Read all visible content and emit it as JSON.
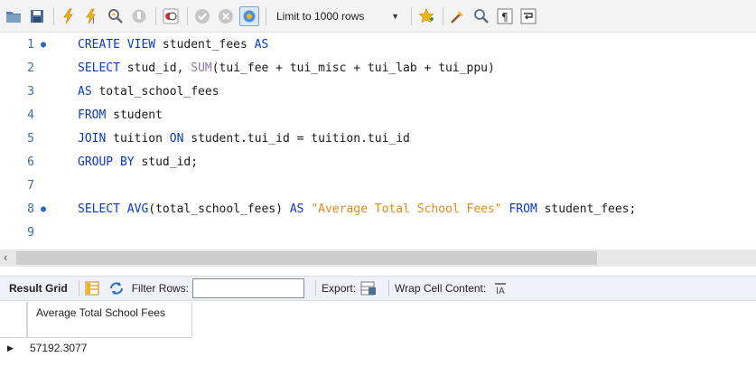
{
  "toolbar": {
    "limit_label": "Limit to 1000 rows",
    "buttons": [
      "open-folder-icon",
      "save-icon",
      "execute-icon",
      "execute-current-icon",
      "explain-icon",
      "stop-icon",
      "toggle-error-icon",
      "commit-icon",
      "rollback-icon",
      "autocommit-icon",
      "favorite-icon",
      "beautify-icon",
      "find-icon",
      "invisible-chars-icon",
      "wrap-icon"
    ]
  },
  "editor": {
    "lines": [
      {
        "num": "1",
        "dot": true
      },
      {
        "num": "2",
        "dot": false
      },
      {
        "num": "3",
        "dot": false
      },
      {
        "num": "4",
        "dot": false
      },
      {
        "num": "5",
        "dot": false
      },
      {
        "num": "6",
        "dot": false
      },
      {
        "num": "7",
        "dot": false
      },
      {
        "num": "8",
        "dot": true
      },
      {
        "num": "9",
        "dot": false
      }
    ],
    "code": {
      "l1_kw": "CREATE VIEW",
      "l1_rest": " student_fees ",
      "l1_as": "AS",
      "l2_kw": "SELECT",
      "l2_a": " stud_id, ",
      "l2_fn": "SUM",
      "l2_rest": "(tui_fee + tui_misc + tui_lab + tui_ppu)",
      "l3_kw": "AS",
      "l3_rest": " total_school_fees",
      "l4_kw": "FROM",
      "l4_rest": " student",
      "l5_kw": "JOIN",
      "l5_a": " tuition ",
      "l5_on": "ON",
      "l5_rest": " student.tui_id = tuition.tui_id",
      "l6_kw": "GROUP BY",
      "l6_rest": " stud_id;",
      "l8_kw": "SELECT",
      "l8_a": " ",
      "l8_fn": "AVG",
      "l8_b": "(total_school_fees) ",
      "l8_as": "AS",
      "l8_c": " ",
      "l8_str": "\"Average Total School Fees\"",
      "l8_d": " ",
      "l8_from": "FROM",
      "l8_rest": " student_fees;"
    }
  },
  "result_bar": {
    "result_grid": "Result Grid",
    "filter_rows": "Filter Rows:",
    "filter_value": "",
    "export": "Export:",
    "wrap": "Wrap Cell Content:"
  },
  "grid": {
    "column_header": "Average Total School Fees",
    "rows": [
      {
        "value": "57192.3077"
      }
    ]
  },
  "colors": {
    "keyword": "#0a39c4",
    "string": "#e08a1e",
    "line_number": "#3a6ea5"
  }
}
